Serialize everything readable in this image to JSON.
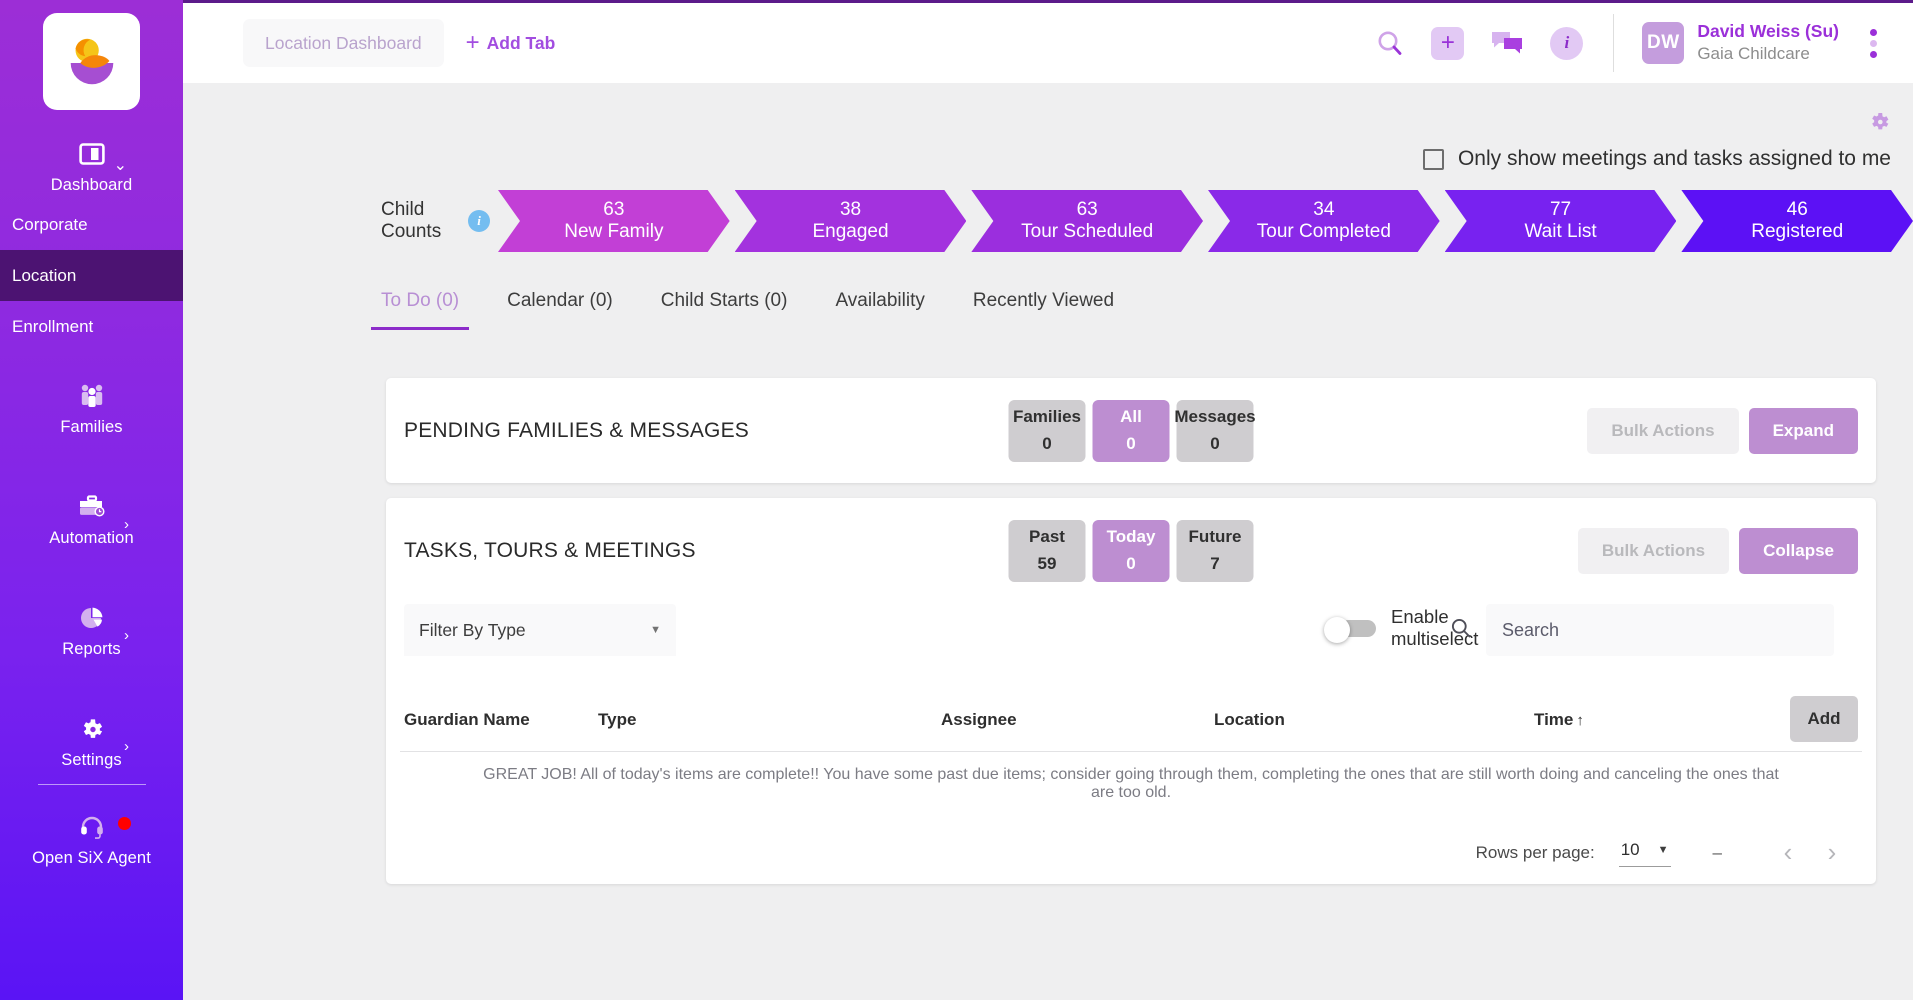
{
  "brand": {
    "logo_icon": "gaia-bowl-logo",
    "colors": {
      "sidebar_top": "#9c2ed6",
      "sidebar_bottom": "#5a14f5",
      "active_nav": "#4c1372",
      "accent_purple": "#9b30d9",
      "pill_active": "#bd8ed1",
      "info_blue": "#74bdf0",
      "alert_red": "#ff0000"
    }
  },
  "sidebar": {
    "dashboard": {
      "label": "Dashboard",
      "icon": "dashboard-panel-icon",
      "chevron": "chevron-down-icon"
    },
    "links": [
      {
        "label": "Corporate",
        "active": false
      },
      {
        "label": "Location",
        "active": true
      },
      {
        "label": "Enrollment",
        "active": false
      }
    ],
    "items": [
      {
        "label": "Families",
        "icon": "families-icon",
        "chevron": ""
      },
      {
        "label": "Automation",
        "icon": "briefcase-clock-icon",
        "chevron": "chevron-right-icon"
      },
      {
        "label": "Reports",
        "icon": "pie-chart-icon",
        "chevron": "chevron-right-icon"
      },
      {
        "label": "Settings",
        "icon": "gear-icon",
        "chevron": "chevron-right-icon"
      }
    ],
    "agent": {
      "label": "Open SiX Agent",
      "icon": "headset-icon",
      "badge": "alert-dot"
    }
  },
  "topbar": {
    "tab_label": "Location Dashboard",
    "add_tab_label": "Add Tab",
    "add_tab_plus": "+",
    "icons": {
      "search": "search-icon",
      "plus": "plus-icon",
      "messages": "chat-bubbles-icon",
      "info": "info-icon"
    },
    "info_glyph": "i",
    "plus_glyph": "+",
    "user": {
      "initials": "DW",
      "name": "David Weiss (Su)",
      "org": "Gaia Childcare"
    }
  },
  "filterbar": {
    "gear_icon": "settings-gear-icon",
    "checkbox_label": "Only show meetings and tasks assigned to me",
    "checkbox_checked": false
  },
  "pipeline": {
    "label_line1": "Child",
    "label_line2": "Counts",
    "info_glyph": "i",
    "segments": [
      {
        "count": "63",
        "name": "New Family",
        "color": "#c23fd6"
      },
      {
        "count": "38",
        "name": "Engaged",
        "color": "#a332de"
      },
      {
        "count": "63",
        "name": "Tour Scheduled",
        "color": "#9b2ede"
      },
      {
        "count": "34",
        "name": "Tour Completed",
        "color": "#8a29e8"
      },
      {
        "count": "77",
        "name": "Wait List",
        "color": "#7822f0"
      },
      {
        "count": "46",
        "name": "Registered",
        "color": "#5c11f5"
      }
    ]
  },
  "tabs": [
    {
      "label": "To Do (0)",
      "active": true
    },
    {
      "label": "Calendar (0)",
      "active": false
    },
    {
      "label": "Child Starts (0)",
      "active": false
    },
    {
      "label": "Availability",
      "active": false
    },
    {
      "label": "Recently Viewed",
      "active": false
    }
  ],
  "pending_card": {
    "title": "PENDING FAMILIES & MESSAGES",
    "pills": [
      {
        "label": "Families",
        "value": "0",
        "active": false
      },
      {
        "label": "All",
        "value": "0",
        "active": true
      },
      {
        "label": "Messages",
        "value": "0",
        "active": false
      }
    ],
    "bulk_actions_label": "Bulk Actions",
    "expand_label": "Expand"
  },
  "tasks_card": {
    "title": "TASKS, TOURS & MEETINGS",
    "pills": [
      {
        "label": "Past",
        "value": "59",
        "active": false
      },
      {
        "label": "Today",
        "value": "0",
        "active": true
      },
      {
        "label": "Future",
        "value": "7",
        "active": false
      }
    ],
    "bulk_actions_label": "Bulk Actions",
    "collapse_label": "Collapse",
    "filter_select": {
      "value": "Filter By Type",
      "caret": "▼"
    },
    "multiselect": {
      "label_line1": "Enable",
      "label_line2": "multiselect",
      "on": false
    },
    "search": {
      "placeholder": "Search",
      "value": "",
      "icon": "search-icon"
    },
    "table": {
      "columns": [
        {
          "label": "Guardian Name",
          "sort": ""
        },
        {
          "label": "Type",
          "sort": ""
        },
        {
          "label": "Assignee",
          "sort": ""
        },
        {
          "label": "Location",
          "sort": ""
        },
        {
          "label": "Time",
          "sort": "↑"
        }
      ],
      "add_label": "Add",
      "empty_message": "GREAT JOB! All of today's items are complete!! You have some past due items; consider going through them, completing the ones that are still worth doing and canceling the ones that are too old."
    },
    "pager": {
      "rows_label": "Rows per page:",
      "rows_value": "10",
      "rows_caret": "▼",
      "range": "–",
      "prev": "‹",
      "next": "›"
    }
  }
}
